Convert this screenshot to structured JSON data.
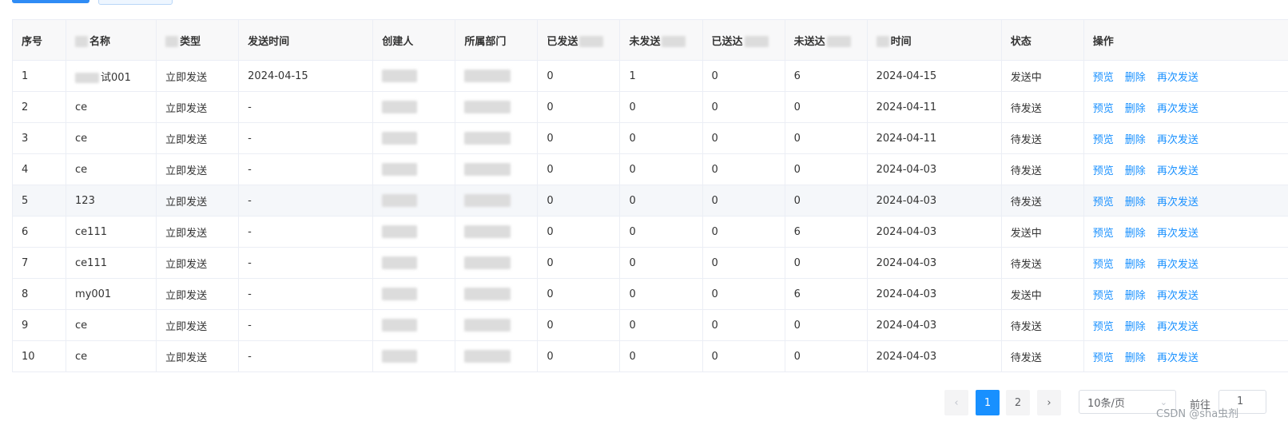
{
  "headers": {
    "index": "序号",
    "name_suffix": "名称",
    "type_suffix": "类型",
    "send_time": "发送时间",
    "creator": "创建人",
    "department": "所属部门",
    "sent_prefix": "已发送",
    "unsent_prefix": "未发送",
    "delivered_prefix": "已送达",
    "undelivered_prefix": "未送达",
    "created_time_tail": "时间",
    "status": "状态",
    "actions": "操作"
  },
  "actions": {
    "preview": "预览",
    "delete": "删除",
    "resend": "再次发送"
  },
  "rows": [
    {
      "index": "1",
      "name": "试001",
      "type": "立即发送",
      "send_time": "2024-04-15",
      "sent": "0",
      "unsent": "1",
      "delivered": "0",
      "undelivered": "6",
      "created": "2024-04-15",
      "status": "发送中"
    },
    {
      "index": "2",
      "name": "ce",
      "type": "立即发送",
      "send_time": "-",
      "sent": "0",
      "unsent": "0",
      "delivered": "0",
      "undelivered": "0",
      "created": "2024-04-11",
      "status": "待发送"
    },
    {
      "index": "3",
      "name": "ce",
      "type": "立即发送",
      "send_time": "-",
      "sent": "0",
      "unsent": "0",
      "delivered": "0",
      "undelivered": "0",
      "created": "2024-04-11",
      "status": "待发送"
    },
    {
      "index": "4",
      "name": "ce",
      "type": "立即发送",
      "send_time": "-",
      "sent": "0",
      "unsent": "0",
      "delivered": "0",
      "undelivered": "0",
      "created": "2024-04-03",
      "status": "待发送"
    },
    {
      "index": "5",
      "name": "123",
      "type": "立即发送",
      "send_time": "-",
      "sent": "0",
      "unsent": "0",
      "delivered": "0",
      "undelivered": "0",
      "created": "2024-04-03",
      "status": "待发送"
    },
    {
      "index": "6",
      "name": "ce111",
      "type": "立即发送",
      "send_time": "-",
      "sent": "0",
      "unsent": "0",
      "delivered": "0",
      "undelivered": "6",
      "created": "2024-04-03",
      "status": "发送中"
    },
    {
      "index": "7",
      "name": "ce111",
      "type": "立即发送",
      "send_time": "-",
      "sent": "0",
      "unsent": "0",
      "delivered": "0",
      "undelivered": "0",
      "created": "2024-04-03",
      "status": "待发送"
    },
    {
      "index": "8",
      "name": "my001",
      "type": "立即发送",
      "send_time": "-",
      "sent": "0",
      "unsent": "0",
      "delivered": "0",
      "undelivered": "6",
      "created": "2024-04-03",
      "status": "发送中"
    },
    {
      "index": "9",
      "name": "ce",
      "type": "立即发送",
      "send_time": "-",
      "sent": "0",
      "unsent": "0",
      "delivered": "0",
      "undelivered": "0",
      "created": "2024-04-03",
      "status": "待发送"
    },
    {
      "index": "10",
      "name": "ce",
      "type": "立即发送",
      "send_time": "-",
      "sent": "0",
      "unsent": "0",
      "delivered": "0",
      "undelivered": "0",
      "created": "2024-04-03",
      "status": "待发送"
    }
  ],
  "pagination": {
    "prev": "‹",
    "next": "›",
    "pages": [
      "1",
      "2"
    ],
    "page_size": "10条/页",
    "goto_label": "前往",
    "goto_value": "1"
  },
  "watermark": "CSDN @sha虫剂",
  "colors": {
    "primary": "#1890ff",
    "header_bg": "#f8f8f9",
    "border": "#ebeef5"
  }
}
